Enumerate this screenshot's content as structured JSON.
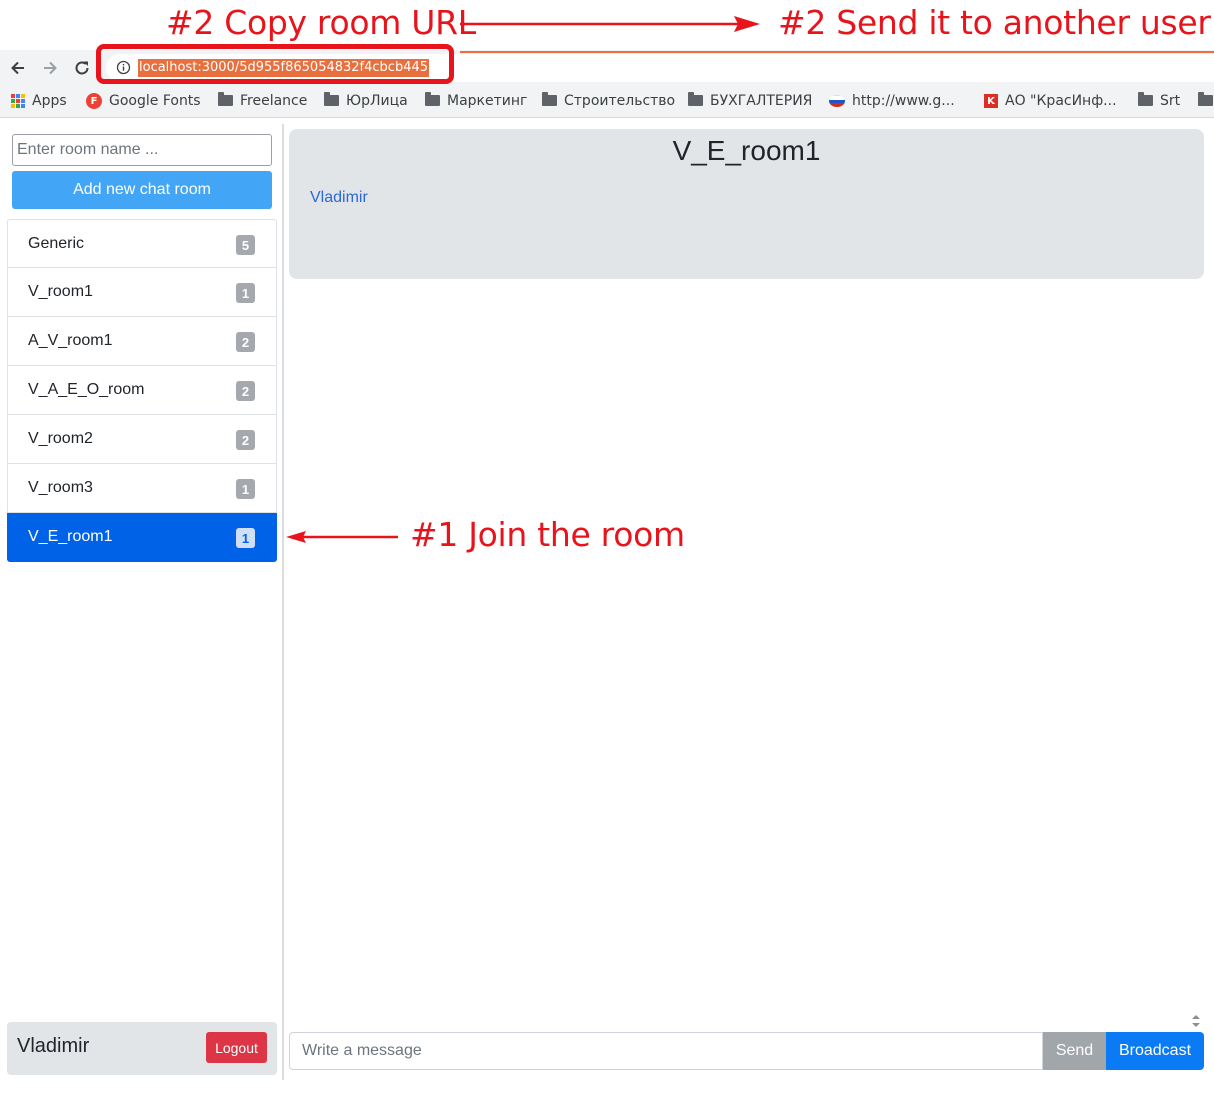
{
  "annotations": {
    "copy_url": "#2 Copy room URL",
    "send_to_user": "#2 Send it to another user",
    "join_room": "#1 Join the room",
    "color": "#e8141c"
  },
  "browser": {
    "url": "localhost:3000/5d955f865054832f4cbcb445",
    "icons": [
      "back-icon",
      "forward-icon",
      "reload-icon",
      "info-icon"
    ],
    "bookmarks": [
      {
        "label": "Apps",
        "icon": "apps-icon"
      },
      {
        "label": "Google Fonts",
        "icon": "google-fonts-icon"
      },
      {
        "label": "Freelance",
        "icon": "folder-icon"
      },
      {
        "label": "ЮрЛица",
        "icon": "folder-icon"
      },
      {
        "label": "Маркетинг",
        "icon": "folder-icon"
      },
      {
        "label": "Строительство",
        "icon": "folder-icon"
      },
      {
        "label": "БУХГАЛТЕРИЯ",
        "icon": "folder-icon"
      },
      {
        "label": "http://www.g...",
        "icon": "russia-flag-icon"
      },
      {
        "label": "АО \"КрасИнф...",
        "icon": "k-icon"
      },
      {
        "label": "Srt",
        "icon": "folder-icon"
      }
    ]
  },
  "sidebar": {
    "room_input_placeholder": "Enter room name ...",
    "add_room_label": "Add new chat room",
    "rooms": [
      {
        "name": "Generic",
        "count": "5"
      },
      {
        "name": "V_room1",
        "count": "1"
      },
      {
        "name": "A_V_room1",
        "count": "2"
      },
      {
        "name": "V_A_E_O_room",
        "count": "2"
      },
      {
        "name": "V_room2",
        "count": "2"
      },
      {
        "name": "V_room3",
        "count": "1"
      },
      {
        "name": "V_E_room1",
        "count": "1"
      }
    ],
    "active_room_index": 6,
    "user_name": "Vladimir",
    "logout_label": "Logout"
  },
  "main": {
    "room_title": "V_E_room1",
    "members": [
      "Vladimir"
    ],
    "message_placeholder": "Write a message",
    "send_label": "Send",
    "broadcast_label": "Broadcast"
  },
  "colors": {
    "active_room": "#0062e6",
    "add_room_button": "#42a5f5",
    "logout_button": "#dc3545",
    "send_button": "#a1a6ab",
    "broadcast_button": "#0a7bf5",
    "url_selection": "#e8703e"
  }
}
